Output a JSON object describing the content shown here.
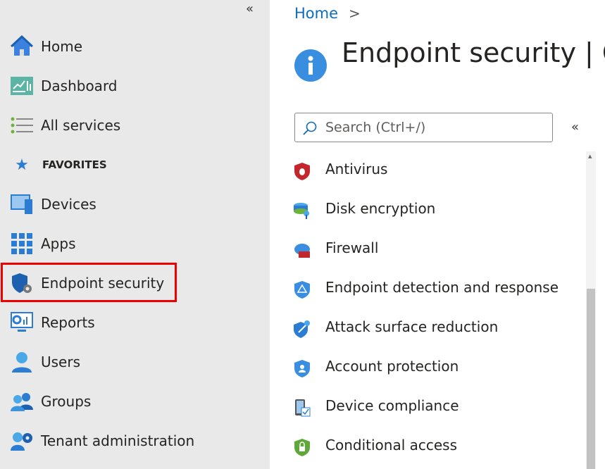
{
  "sidebar": {
    "collapse_icon": "chevron-double-left-icon",
    "items": [
      {
        "label": "Home",
        "icon": "home-icon"
      },
      {
        "label": "Dashboard",
        "icon": "dashboard-icon"
      },
      {
        "label": "All services",
        "icon": "list-icon"
      },
      {
        "label": "FAVORITES",
        "icon": "star-icon"
      },
      {
        "label": "Devices",
        "icon": "devices-icon"
      },
      {
        "label": "Apps",
        "icon": "apps-icon"
      },
      {
        "label": "Endpoint security",
        "icon": "endpoint-security-icon",
        "highlighted": true
      },
      {
        "label": "Reports",
        "icon": "reports-icon"
      },
      {
        "label": "Users",
        "icon": "users-icon"
      },
      {
        "label": "Groups",
        "icon": "groups-icon"
      },
      {
        "label": "Tenant administration",
        "icon": "tenant-admin-icon"
      }
    ],
    "highlight_color": "#e00000"
  },
  "main": {
    "breadcrumb": {
      "home": "Home",
      "separator": ">"
    },
    "title": "Endpoint security | O",
    "search": {
      "placeholder": "Search (Ctrl+/)"
    },
    "menu": [
      {
        "label": "Antivirus",
        "icon": "antivirus-icon"
      },
      {
        "label": "Disk encryption",
        "icon": "disk-encryption-icon"
      },
      {
        "label": "Firewall",
        "icon": "firewall-icon"
      },
      {
        "label": "Endpoint detection and response",
        "icon": "edr-icon"
      },
      {
        "label": "Attack surface reduction",
        "icon": "attack-surface-icon"
      },
      {
        "label": "Account protection",
        "icon": "account-protection-icon"
      },
      {
        "label": "Device compliance",
        "icon": "device-compliance-icon"
      },
      {
        "label": "Conditional access",
        "icon": "conditional-access-icon"
      }
    ]
  },
  "colors": {
    "accent": "#0f6cbd",
    "sidebar_bg": "#e9e9e9"
  }
}
